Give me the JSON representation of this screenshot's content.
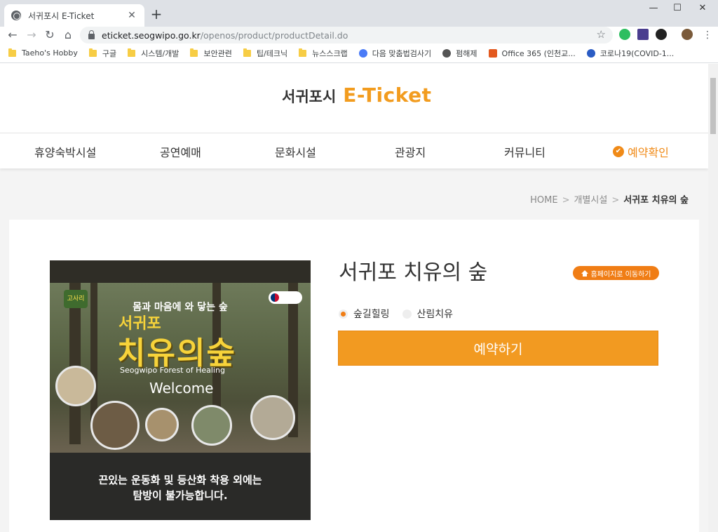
{
  "browser": {
    "tab_title": "서귀포시 E-Ticket",
    "tab_close": "✕",
    "new_tab": "+",
    "url_host": "eticket.seogwipo.go.kr",
    "url_path": "/openos/product/productDetail.do",
    "window": {
      "minimize": "—",
      "maximize": "☐",
      "close": "✕"
    },
    "bookmarks": [
      {
        "label": "Taeho's Hobby",
        "icon": "folder-icon"
      },
      {
        "label": "구글",
        "icon": "folder-icon"
      },
      {
        "label": "시스템/개발",
        "icon": "folder-icon"
      },
      {
        "label": "보안관련",
        "icon": "folder-icon"
      },
      {
        "label": "팁/테크닉",
        "icon": "folder-icon"
      },
      {
        "label": "뉴스스크랩",
        "icon": "folder-icon"
      },
      {
        "label": "다음 맞춤법검사기",
        "icon": "daum-icon"
      },
      {
        "label": "펌해제",
        "icon": "globe-icon"
      },
      {
        "label": "Office 365 (인천교...",
        "icon": "office-icon"
      },
      {
        "label": "코로나19(COVID-1...",
        "icon": "covid-site-icon"
      }
    ]
  },
  "site": {
    "logo_ko": "서귀포시",
    "logo_en": "E-Ticket",
    "nav": [
      "휴양숙박시설",
      "공연예매",
      "문화시설",
      "관광지",
      "커뮤니티",
      "예약확인"
    ],
    "breadcrumb": {
      "home": "HOME",
      "section": "개별시설",
      "current": "서귀포 치유의 숲",
      "sep": ">"
    }
  },
  "product": {
    "title": "서귀포 치유의 숲",
    "homepage_button": "홈페이지로 이동하기",
    "options": [
      {
        "label": "숲길힐링",
        "selected": true
      },
      {
        "label": "산림치유",
        "selected": false
      }
    ],
    "reserve_button": "예약하기",
    "poster": {
      "logo_left": "고사리",
      "sub_title": "몸과 마음에 와 닿는 숲",
      "title_line1": "서귀포",
      "title_line2": "치유의숲",
      "english_title": "Seogwipo Forest of Healing",
      "welcome": "Welcome",
      "notice_line1": "끈있는 운동화 및 등산화 착용 외에는",
      "notice_line2": "탐방이 불가능합니다."
    }
  },
  "colors": {
    "accent": "#f08a17",
    "button": "#f29a21",
    "logo_en": "#f29c1f"
  }
}
